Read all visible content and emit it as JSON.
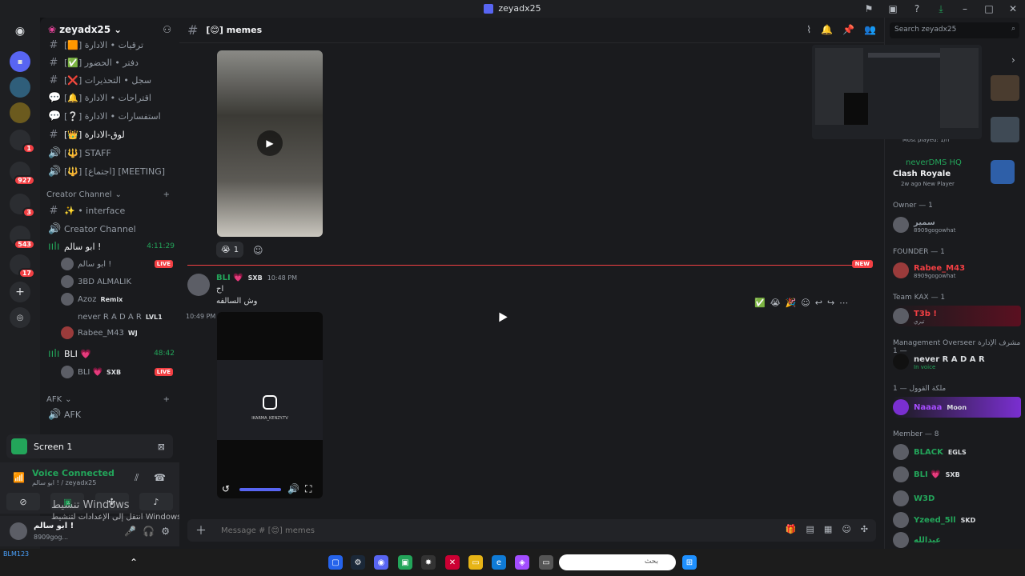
{
  "window": {
    "title": "zeyadx25"
  },
  "server": {
    "name": "zeyadx25"
  },
  "channels": [
    {
      "label": "[🟧] ترقيات • الادارة",
      "icon": "hash-icon"
    },
    {
      "label": "[✅] دفتر • الحضور",
      "icon": "hash-icon"
    },
    {
      "label": "[❌] سجل • التحذيرات",
      "icon": "hash-icon"
    },
    {
      "label": "[🔔] اقتراحات • الادارة",
      "icon": "forum-icon"
    },
    {
      "label": "[❔] استفسارات • الادارة",
      "icon": "forum-icon"
    },
    {
      "label": "[👑] لوق-الادارة",
      "icon": "hash-icon"
    },
    {
      "label": "[🔱] STAFF",
      "icon": "speaker-icon"
    },
    {
      "label": "[🔱] [اجتماع] [MEETING]",
      "icon": "speaker-icon"
    }
  ],
  "creator_category": {
    "label": "Creator Channel"
  },
  "creator_channels": [
    {
      "label": "✨ • interface",
      "icon": "hash-icon"
    },
    {
      "label": "Creator Channel",
      "icon": "speaker-icon"
    }
  ],
  "voice1": {
    "name": "ابو سالم !",
    "timer": "4:11:29"
  },
  "voice1_users": [
    {
      "name": "ابو سالم !",
      "badge": "LIVE"
    },
    {
      "name": "3BD ALMALIK",
      "badge": ""
    },
    {
      "name": "Azoz",
      "badge": "Remix"
    },
    {
      "name": "never R A D A R",
      "badge": "LVL1"
    },
    {
      "name": "Rabee_M43",
      "badge": "WJ"
    }
  ],
  "voice2": {
    "name": "BLI 💗",
    "timer": "48:42"
  },
  "voice2_users": [
    {
      "name": "BLI 💗",
      "tag": "SXB",
      "badge": "LIVE"
    }
  ],
  "afk_category": {
    "label": "AFK"
  },
  "afk_channel": {
    "label": "AFK"
  },
  "screen_panel": {
    "label": "Screen 1"
  },
  "voice_panel": {
    "status": "Voice Connected",
    "sub": "ابو سالم ! / zeyadx25"
  },
  "user_panel": {
    "name": "ابو سالم !",
    "sub": "8909gog..."
  },
  "watermark": {
    "line1": "تنشيط Windows",
    "line2": "انتقل إلى الإعدادات لتنشيط Windows"
  },
  "chat": {
    "channel_name": "[😊] memes",
    "reaction_count": "1",
    "new_label": "NEW",
    "author": "BLI 💗",
    "author_tag": "SXB",
    "msg_time": "10:48 PM",
    "line1": "اح",
    "line2": "وش السالفه",
    "time2": "10:49 PM",
    "video_caption": "IKARMA_KENZY.TV",
    "composer_placeholder": "Message # [😊] memes"
  },
  "search": {
    "placeholder": "Search zeyadx25"
  },
  "preview": {
    "most_played": "Most played: 1/h"
  },
  "activity": {
    "name": "neverDMS HQ",
    "game": "Clash Royale",
    "meta": "2w ago  New Player"
  },
  "member_groups": [
    {
      "label": "Owner — 1"
    },
    {
      "label": "FOUNDER — 1"
    },
    {
      "label": "Team KAX — 1"
    },
    {
      "label": "Management Overseer مشرف الإدارة — 1"
    },
    {
      "label": "ملكة القوول — 1"
    },
    {
      "label": "Member — 8"
    }
  ],
  "members": [
    {
      "name": "سمير",
      "sub": "8909gogowhat",
      "color": "#949ba4"
    },
    {
      "name": "Rabee_M43",
      "sub": "8909gogowhat",
      "color": "#f23f43"
    },
    {
      "name": "T3b !",
      "sub": "تيري",
      "color": "#f23f43"
    },
    {
      "name": "never R A D A R",
      "sub": "In voice",
      "color": "#dbdee1"
    },
    {
      "name": "Naaaa",
      "sub": "Moon",
      "color": "#a64dff"
    },
    {
      "name": "BLACK",
      "sub": "EGLS",
      "color": "#23a55a"
    },
    {
      "name": "BLI 💗",
      "sub": "SXB",
      "color": "#23a55a"
    },
    {
      "name": "W3D",
      "sub": "",
      "color": "#23a55a"
    },
    {
      "name": "Yzeed_5ll",
      "sub": "SKD",
      "color": "#23a55a"
    },
    {
      "name": "عبدالله",
      "sub": "",
      "color": "#23a55a"
    }
  ],
  "taskbar": {
    "search_placeholder": "بحث",
    "tray_text": "BLM123"
  }
}
